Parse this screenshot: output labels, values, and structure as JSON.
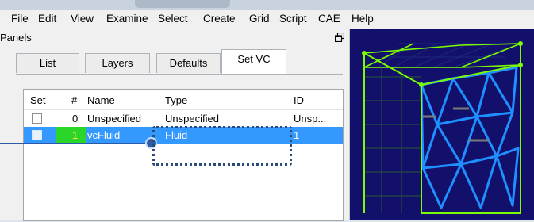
{
  "menu": [
    {
      "label": "File"
    },
    {
      "label": "Edit"
    },
    {
      "label": "View"
    },
    {
      "label": "Examine"
    },
    {
      "label": "Select"
    },
    {
      "label": "Create"
    },
    {
      "label": "Grid"
    },
    {
      "label": "Script"
    },
    {
      "label": "CAE"
    },
    {
      "label": "Help"
    }
  ],
  "panel": {
    "title": "Panels",
    "tabs": [
      {
        "label": "List",
        "active": false
      },
      {
        "label": "Layers",
        "active": false
      },
      {
        "label": "Defaults",
        "active": false
      },
      {
        "label": "Set VC",
        "active": true
      }
    ]
  },
  "table": {
    "columns": [
      "Set",
      "#",
      "Name",
      "Type",
      "ID"
    ],
    "rows": [
      {
        "checked": false,
        "num": "0",
        "name": "Unspecified",
        "type": "Unspecified",
        "id": "Unsp...",
        "selected": false
      },
      {
        "checked": false,
        "num": "1",
        "name": "vcFluid",
        "type": "Fluid",
        "id": "1",
        "selected": true
      }
    ]
  },
  "colors": {
    "selection": "#3399ff",
    "id_highlight": "#2bd62b",
    "viewport_bg": "#13106b",
    "mesh_green": "#7cfc00",
    "mesh_blue": "#1e90ff"
  }
}
